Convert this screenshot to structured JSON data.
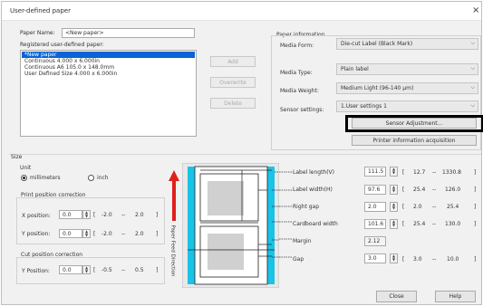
{
  "window": {
    "title": "User-defined paper",
    "close_glyph": "×"
  },
  "paper_name": {
    "label": "Paper Name:",
    "value": "<New paper>"
  },
  "registered": {
    "label": "Registered user-defined paper:",
    "items": [
      "*New paper",
      "Continuous 4.000 x 6.000in",
      "Continuous A6 105.0 x 148.0mm",
      "User Defined Size 4.000 x 6.000in"
    ]
  },
  "list_buttons": {
    "add": "Add",
    "overwrite": "Overwrite",
    "delete": "Delete"
  },
  "paper_info": {
    "group_label": "Paper information",
    "media_form": {
      "label": "Media Form:",
      "value": "Die-cut Label (Black Mark)"
    },
    "media_type": {
      "label": "Media Type:",
      "value": "Plain label"
    },
    "media_weight": {
      "label": "Media Weight:",
      "value": "Medium Light (96-140 µm)"
    },
    "sensor": {
      "label": "Sensor settings:",
      "value": "1.User settings 1"
    },
    "sensor_adjust_button": "Sensor Adjustment...",
    "printer_info_button": "Printer information acquisition"
  },
  "size": {
    "group_label": "Size",
    "unit_label": "Unit",
    "unit_mm": "millimeters",
    "unit_inch": "inch",
    "unit_selected": "millimeters"
  },
  "print_pos": {
    "group_label": "Print position correction",
    "x": {
      "label": "X position:",
      "value": "0.0",
      "range_min": "-2.0",
      "range_max": "2.0"
    },
    "y": {
      "label": "Y position:",
      "value": "0.0",
      "range_min": "-2.0",
      "range_max": "2.0"
    }
  },
  "cut_pos": {
    "group_label": "Cut position correction",
    "y": {
      "label": "Y Position:",
      "value": "0.0",
      "range_min": "-0.5",
      "range_max": "0.5"
    }
  },
  "feed_direction": "Paper Feed Direction",
  "dimensions": [
    {
      "label": "Label length(V)",
      "value": "111.5",
      "min": "12.7",
      "max": "1330.8"
    },
    {
      "label": "Label width(H)",
      "value": "97.6",
      "min": "25.4",
      "max": "126.0"
    },
    {
      "label": "Right gap",
      "value": "2.0",
      "min": "2.0",
      "max": "25.4"
    },
    {
      "label": "Cardboard width",
      "value": "101.6",
      "min": "25.4",
      "max": "130.0"
    },
    {
      "label": "Margin",
      "value": "2.12"
    },
    {
      "label": "Gap",
      "value": "3.0",
      "min": "3.0",
      "max": "10.0"
    }
  ],
  "range_sym": {
    "open": "[",
    "dash": "--",
    "close": "]"
  },
  "footer": {
    "close_label": "Close",
    "help_label": "Help"
  },
  "colors": {
    "accent": "#0a64d6",
    "guide_cyan": "#19c3e6",
    "arrow_red": "#e0201c",
    "highlight_box": "#000000"
  }
}
